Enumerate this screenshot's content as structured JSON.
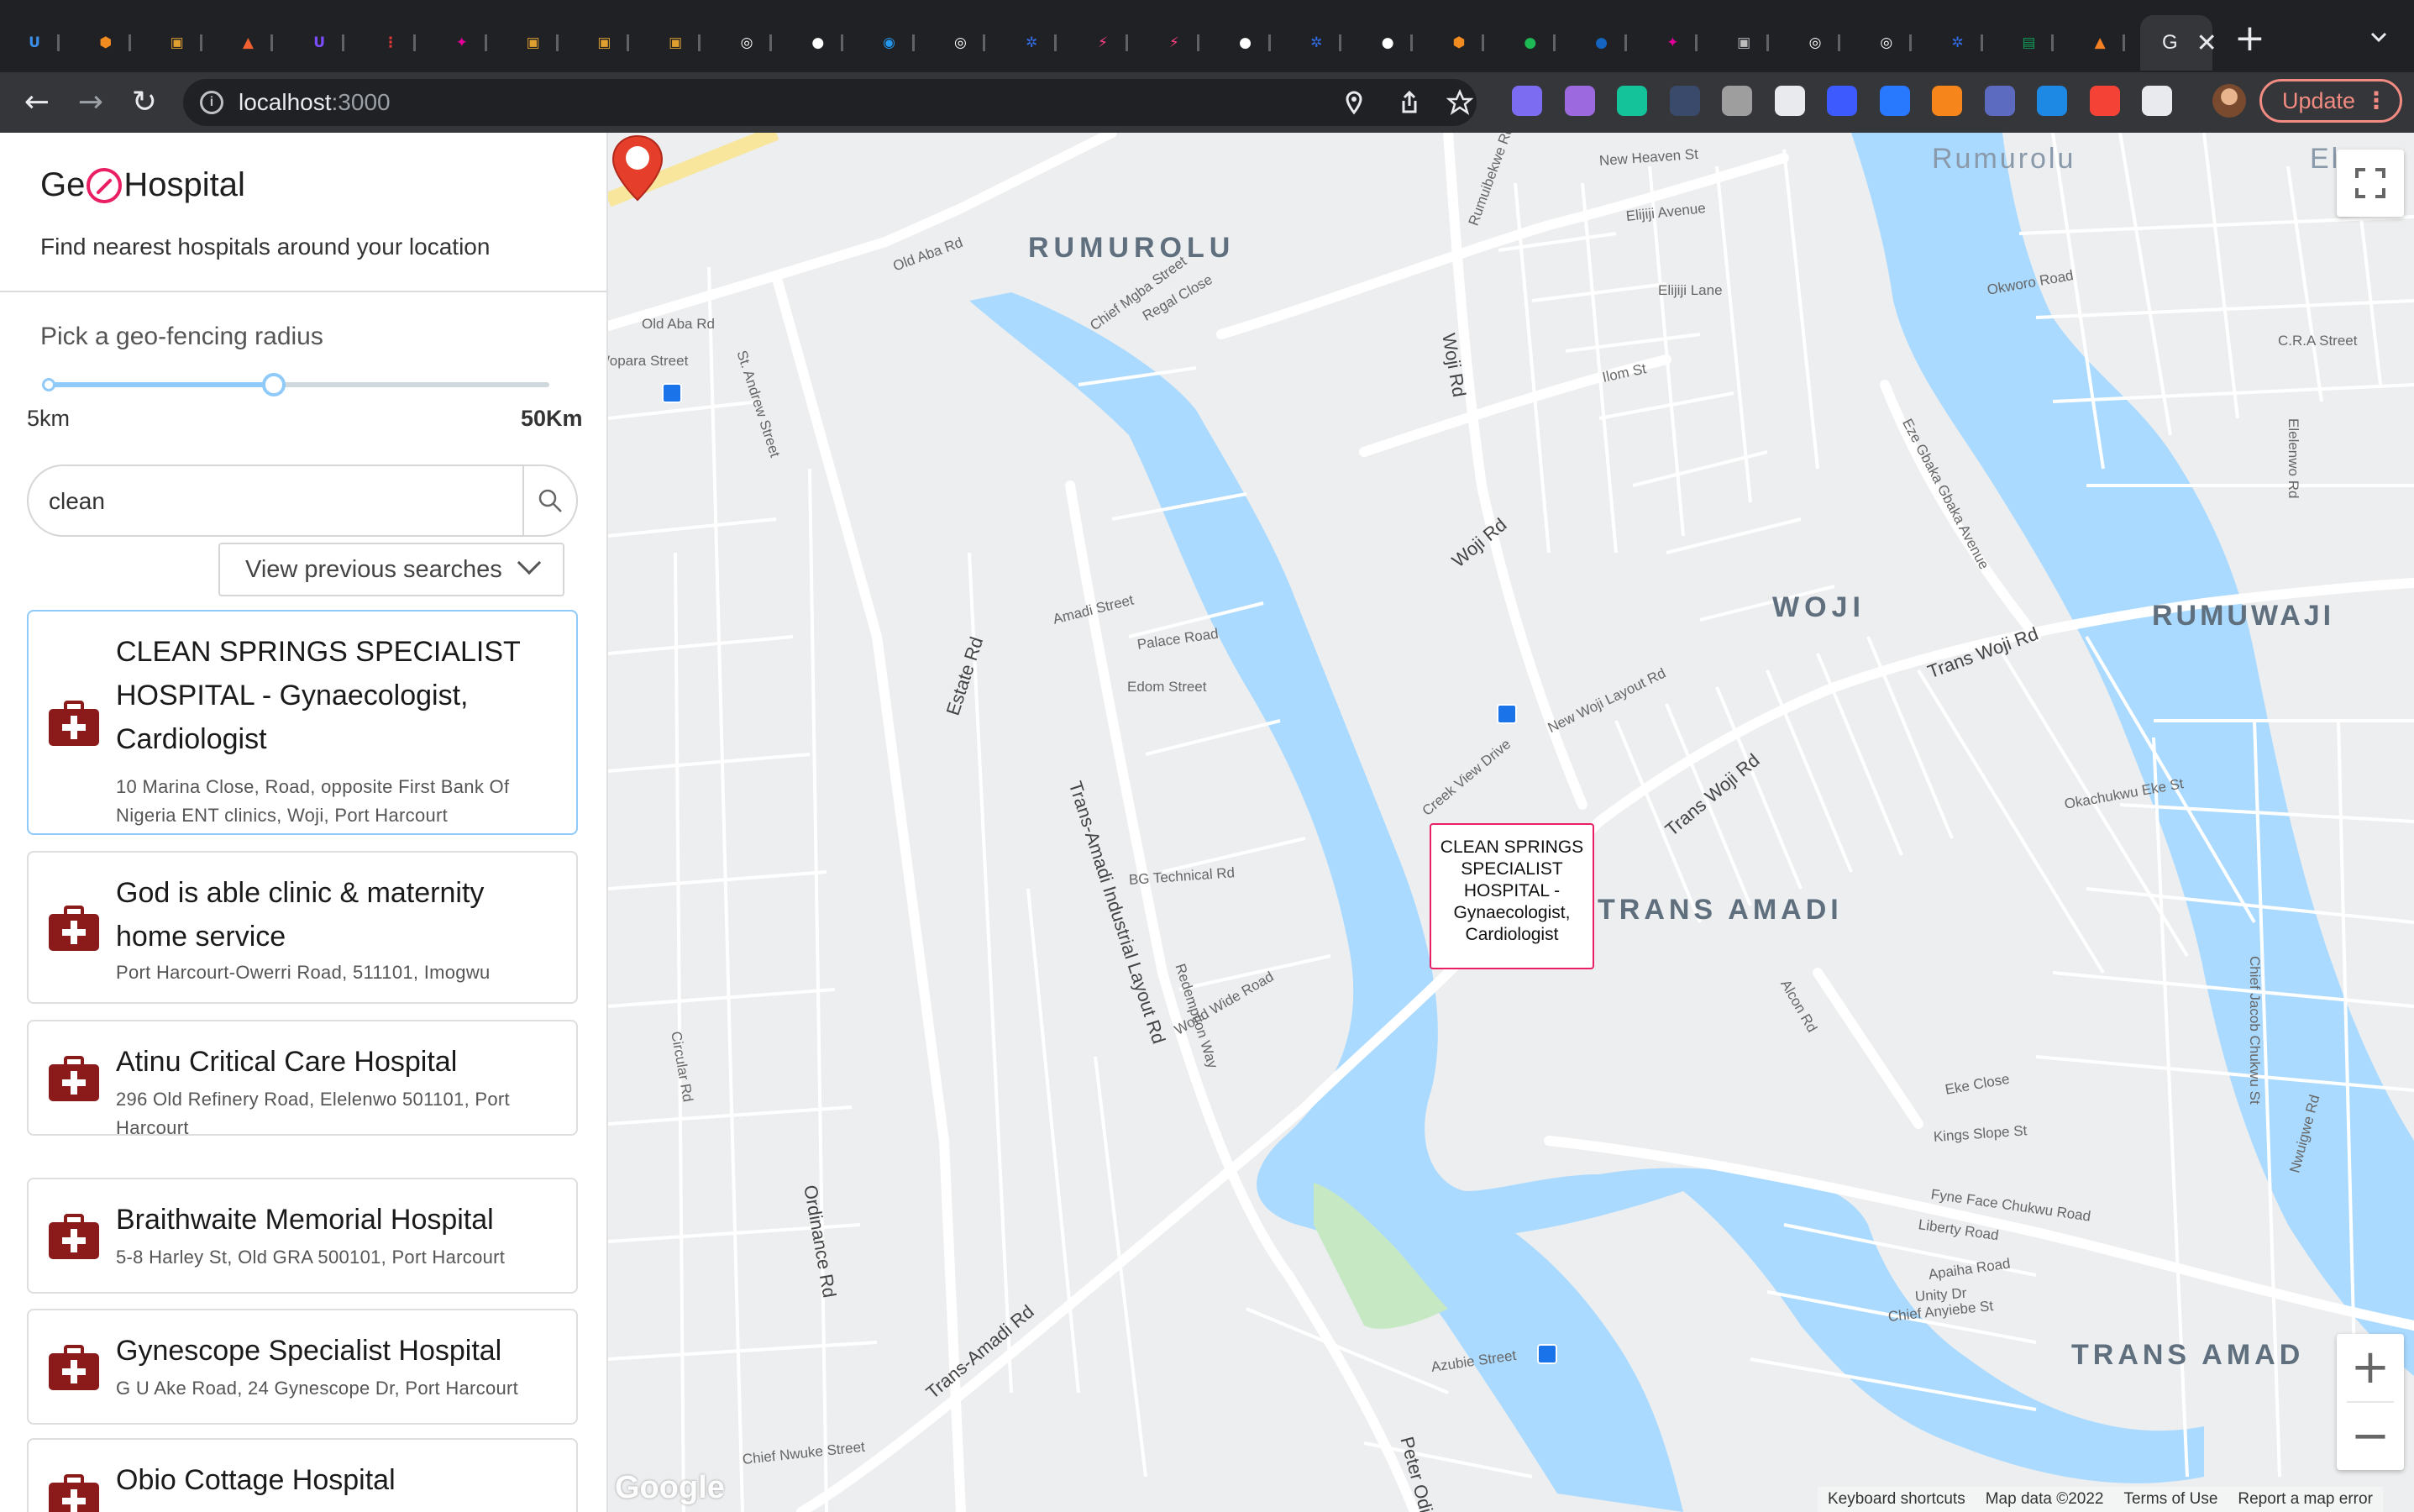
{
  "browser": {
    "active_tab_title": "G",
    "new_tab_symbol": "+",
    "url_host": "localhost",
    "url_port": ":3000",
    "update_label": "Update",
    "tabs": [
      {
        "icon": "unknown-tab-icon",
        "color": "#3b8ee8",
        "glyph": "U"
      },
      {
        "icon": "box-icon",
        "color": "#f28b20",
        "glyph": ""
      },
      {
        "icon": "package-icon",
        "color": "#e0a030",
        "glyph": ""
      },
      {
        "icon": "brave-icon",
        "color": "#f06030",
        "glyph": ""
      },
      {
        "icon": "u-circle-icon",
        "color": "#7c4dff",
        "glyph": "U"
      },
      {
        "icon": "chart-icon",
        "color": "#e53935",
        "glyph": ""
      },
      {
        "icon": "graphql-icon",
        "color": "#e10098",
        "glyph": ""
      },
      {
        "icon": "package-icon",
        "color": "#e0a030",
        "glyph": ""
      },
      {
        "icon": "package-icon",
        "color": "#e0a030",
        "glyph": ""
      },
      {
        "icon": "package-icon",
        "color": "#e0a030",
        "glyph": ""
      },
      {
        "icon": "circle-icon",
        "color": "#ffffff",
        "glyph": ""
      },
      {
        "icon": "github-icon",
        "color": "#ffffff",
        "glyph": ""
      },
      {
        "icon": "docker-icon",
        "color": "#2496ed",
        "glyph": ""
      },
      {
        "icon": "circle-icon",
        "color": "#ffffff",
        "glyph": ""
      },
      {
        "icon": "kubernetes-icon",
        "color": "#326ce5",
        "glyph": ""
      },
      {
        "icon": "zap-icon",
        "color": "#ff4081",
        "glyph": ""
      },
      {
        "icon": "zap-icon",
        "color": "#ff4081",
        "glyph": ""
      },
      {
        "icon": "github-icon",
        "color": "#ffffff",
        "glyph": ""
      },
      {
        "icon": "kubernetes-icon",
        "color": "#326ce5",
        "glyph": ""
      },
      {
        "icon": "github-icon",
        "color": "#ffffff",
        "glyph": ""
      },
      {
        "icon": "box-icon",
        "color": "#f28b20",
        "glyph": ""
      },
      {
        "icon": "spotify-icon",
        "color": "#1db954",
        "glyph": ""
      },
      {
        "icon": "globe-icon",
        "color": "#1565c0",
        "glyph": ""
      },
      {
        "icon": "graphql-icon",
        "color": "#e10098",
        "glyph": ""
      },
      {
        "icon": "profile-icon",
        "color": "#bdbdbd",
        "glyph": ""
      },
      {
        "icon": "circle-icon",
        "color": "#ffffff",
        "glyph": ""
      },
      {
        "icon": "circle-icon",
        "color": "#ffffff",
        "glyph": ""
      },
      {
        "icon": "kubernetes-icon",
        "color": "#326ce5",
        "glyph": ""
      },
      {
        "icon": "sheets-icon",
        "color": "#0f9d58",
        "glyph": ""
      },
      {
        "icon": "stack-icon",
        "color": "#f48024",
        "glyph": ""
      }
    ],
    "extensions": [
      {
        "icon": "extension-square-icon",
        "color": "#7c6cf2"
      },
      {
        "icon": "extension-brush-icon",
        "color": "#9c6ade"
      },
      {
        "icon": "grammarly-icon",
        "color": "#15c39a"
      },
      {
        "icon": "extension-a-icon",
        "color": "#3a4a6b"
      },
      {
        "icon": "extension-target-icon",
        "color": "#9e9e9e"
      },
      {
        "icon": "extension-octo-icon",
        "color": "#e8eaed"
      },
      {
        "icon": "extension-spark-icon",
        "color": "#3d5afe"
      },
      {
        "icon": "extension-wave-icon",
        "color": "#2979ff"
      },
      {
        "icon": "metamask-icon",
        "color": "#f6851b"
      },
      {
        "icon": "extension-k-icon",
        "color": "#5c6bc0"
      },
      {
        "icon": "extension-arrows-icon",
        "color": "#1e88e5"
      },
      {
        "icon": "extension-tp-icon",
        "color": "#f44336"
      },
      {
        "icon": "puzzle-icon",
        "color": "#e8eaed"
      }
    ]
  },
  "app": {
    "brand_prefix": "Ge",
    "brand_suffix": "Hospital",
    "tagline": "Find nearest hospitals around your location",
    "radius_label": "Pick a geo-fencing radius",
    "radius_min_label": "5km",
    "radius_max_label": "50Km",
    "radius_fraction": 0.45,
    "search_value": "clean",
    "previous_searches_label": "View previous searches",
    "results": [
      {
        "title": "CLEAN SPRINGS SPECIALIST HOSPITAL - Gynaecologist, Cardiologist",
        "address": "10 Marina Close, Road, opposite First Bank Of Nigeria ENT clinics, Woji, Port Harcourt",
        "selected": true
      },
      {
        "title": "God is able clinic & maternity home service",
        "address": "Port Harcourt-Owerri Road, 511101, Imogwu",
        "selected": false
      },
      {
        "title": "Atinu Critical Care Hospital",
        "address": "296 Old Refinery Road, Elelenwo 501101, Port Harcourt",
        "selected": false
      },
      {
        "title": "Braithwaite Memorial Hospital",
        "address": "5-8 Harley St, Old GRA 500101, Port Harcourt",
        "selected": false
      },
      {
        "title": "Gynescope Specialist Hospital",
        "address": "G U Ake Road, 24 Gynescope Dr, Port Harcourt",
        "selected": false
      },
      {
        "title": "Obio Cottage Hospital",
        "address": "",
        "selected": false
      }
    ]
  },
  "map": {
    "infobox_text": "CLEAN SPRINGS SPECIALIST HOSPITAL - Gynaecologist, Cardiologist",
    "areas": [
      "RUMUROLU",
      "WOJI",
      "RUMUWAJI",
      "TRANS AMADI",
      "TRANS AMAD",
      "Rumurolu",
      "El"
    ],
    "streets": [
      "Old Aba Rd",
      "Old Aba Rd",
      "Rumuibekwe Rd",
      "New Heaven St",
      "Elijiji Avenue",
      "Elijiji Lane",
      "Ilom St",
      "Okworo Road",
      "Woji Rd",
      "Woji Rd",
      "Estate Rd",
      "Trans-Amadi Industrial Layout Rd",
      "Trans Woji Rd",
      "Trans Woji Rd",
      "Trans-Amadi Rd",
      "Ordinance Rd",
      "Circular Rd",
      "Peter Odili",
      "Alcon Rd",
      "Eke Close",
      "Kings Slope St",
      "Liberty Road",
      "Amadi Street",
      "Palace Road",
      "Edom Street",
      "Creek View Drive",
      "New Woji Layout Rd",
      "World Wide Road",
      "BG Technical Rd",
      "Azubie Street",
      "Chief Nwuke Street",
      "Unity Dr",
      "Chief Anyiebe St",
      "Eze Gbaka Gbaka Avenue",
      "Elelenwo Rd",
      "C.R.A Street",
      "Nwuigwe Rd",
      "Wopara Street",
      "St. Andrew Street",
      "Chief Mgba Street",
      "Regal Close",
      "Redemption Way",
      "Fyne Face Chukwu Road",
      "Apaiha Road",
      "Okachukwu Eke St",
      "Chief Jacob Chukwu St"
    ],
    "zoom_in": "+",
    "zoom_out": "−",
    "google_logo": "Google",
    "attribution": [
      "Keyboard shortcuts",
      "Map data ©2022",
      "Terms of Use",
      "Report a map error"
    ]
  }
}
